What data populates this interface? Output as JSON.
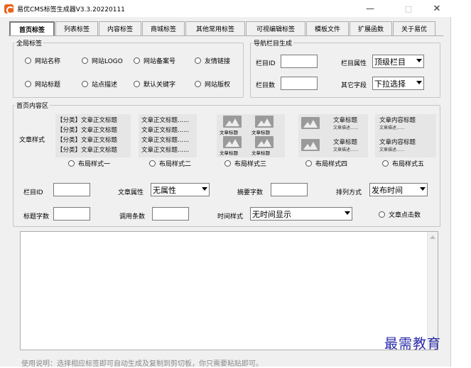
{
  "window": {
    "title": "易优CMS标签生成器V3.3.20220111",
    "controls": {
      "minimize": "—",
      "maximize": "□",
      "close": "✕"
    }
  },
  "tabs": [
    "首页标签",
    "列表标签",
    "内容标签",
    "商城标签",
    "其他常用标签",
    "可视编辑标签",
    "模板文件",
    "扩展函数",
    "关于易优"
  ],
  "global": {
    "legend": "全局标签",
    "radios": [
      "网站名称",
      "网站LOGO",
      "网站备案号",
      "友情链接",
      "网站标题",
      "站点描述",
      "默认关键字",
      "网站版权"
    ]
  },
  "nav": {
    "legend": "导航栏目生成",
    "lm_id_label": "栏目ID",
    "lm_num_label": "栏目数",
    "attr_label": "栏目属性",
    "attr_value": "顶级栏目",
    "other_label": "其它字段",
    "other_value": "下拉选择"
  },
  "home": {
    "legend": "首页内容区",
    "article_style_label": "文章样式",
    "preview1": [
      "【分类】文章正文标题",
      "【分类】文章正文标题",
      "【分类】文章正文标题",
      "【分类】文章正文标题"
    ],
    "preview2": [
      "文章正文标题......",
      "文章正文标题......",
      "文章正文标题......",
      "文章正文标题......"
    ],
    "image_caption": "文章标题",
    "preview4_title": "文章标题",
    "preview4_desc": "文章描述......",
    "preview5_title": "文章内容标题",
    "preview5_desc": "文章描述......",
    "layouts": [
      "布局样式一",
      "布局样式二",
      "布局样式三",
      "布局样式四",
      "布局样式五"
    ],
    "lm_id_label": "栏目ID",
    "article_attr_label": "文章属性",
    "article_attr_value": "无属性",
    "summary_label": "摘要字数",
    "sort_label": "排列方式",
    "sort_value": "发布时间",
    "title_len_label": "标题字数",
    "call_count_label": "调用条数",
    "time_style_label": "时间样式",
    "time_style_value": "无时间显示",
    "click_label": "文章点击数"
  },
  "footer_note": "使用说明：选择相应标签即可自动生成及复制到剪切板，你只需要粘贴即可。",
  "watermark": "最需教育"
}
